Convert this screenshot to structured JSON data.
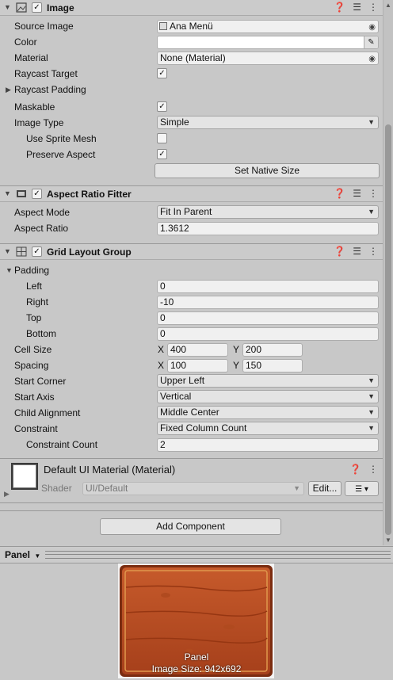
{
  "image": {
    "title": "Image",
    "source_image_label": "Source Image",
    "source_image_value": "Ana Menü",
    "color_label": "Color",
    "material_label": "Material",
    "material_value": "None (Material)",
    "raycast_target_label": "Raycast Target",
    "raycast_padding_label": "Raycast Padding",
    "maskable_label": "Maskable",
    "image_type_label": "Image Type",
    "image_type_value": "Simple",
    "use_sprite_mesh_label": "Use Sprite Mesh",
    "preserve_aspect_label": "Preserve Aspect",
    "set_native_size": "Set Native Size"
  },
  "aspect": {
    "title": "Aspect Ratio Fitter",
    "mode_label": "Aspect Mode",
    "mode_value": "Fit In Parent",
    "ratio_label": "Aspect Ratio",
    "ratio_value": "1.3612"
  },
  "grid": {
    "title": "Grid Layout Group",
    "padding_label": "Padding",
    "left_label": "Left",
    "left_value": "0",
    "right_label": "Right",
    "right_value": "-10",
    "top_label": "Top",
    "top_value": "0",
    "bottom_label": "Bottom",
    "bottom_value": "0",
    "cell_size_label": "Cell Size",
    "cell_x": "400",
    "cell_y": "200",
    "spacing_label": "Spacing",
    "spacing_x": "100",
    "spacing_y": "150",
    "x_label": "X",
    "y_label": "Y",
    "start_corner_label": "Start Corner",
    "start_corner_value": "Upper Left",
    "start_axis_label": "Start Axis",
    "start_axis_value": "Vertical",
    "child_alignment_label": "Child Alignment",
    "child_alignment_value": "Middle Center",
    "constraint_label": "Constraint",
    "constraint_value": "Fixed Column Count",
    "constraint_count_label": "Constraint Count",
    "constraint_count_value": "2"
  },
  "material": {
    "title": "Default UI Material (Material)",
    "shader_label": "Shader",
    "shader_value": "UI/Default",
    "edit_button": "Edit..."
  },
  "add_component": "Add Component",
  "preview": {
    "tab_label": "Panel",
    "name": "Panel",
    "size": "Image Size: 942x692"
  }
}
